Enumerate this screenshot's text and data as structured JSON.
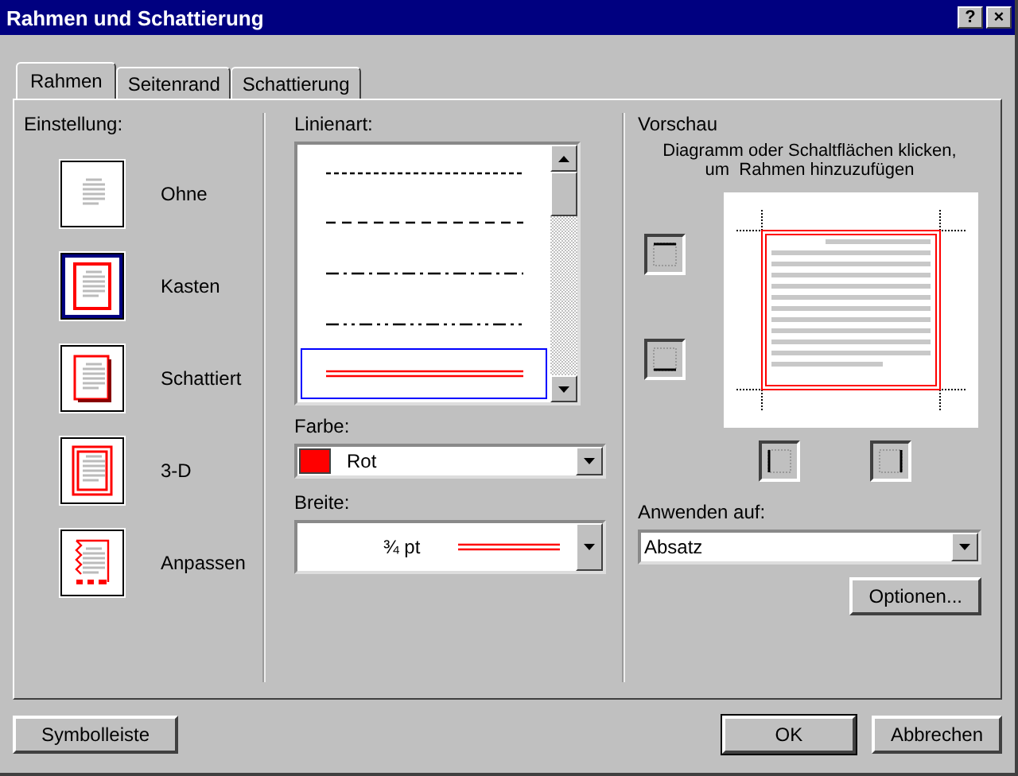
{
  "window": {
    "title": "Rahmen und Schattierung",
    "help_button": "?",
    "close_button": "×"
  },
  "tabs": [
    {
      "label": "Rahmen",
      "selected": true
    },
    {
      "label": "Seitenrand",
      "selected": false
    },
    {
      "label": "Schattierung",
      "selected": false
    }
  ],
  "settings": {
    "label": "Einstellung:",
    "items": [
      {
        "label": "Ohne",
        "kind": "none",
        "selected": false
      },
      {
        "label": "Kasten",
        "kind": "box",
        "selected": true
      },
      {
        "label": "Schattiert",
        "kind": "shadow",
        "selected": false
      },
      {
        "label": "3-D",
        "kind": "threed",
        "selected": false
      },
      {
        "label": "Anpassen",
        "kind": "custom",
        "selected": false
      }
    ]
  },
  "line_style": {
    "label": "Linienart:",
    "items": [
      {
        "kind": "dotted",
        "selected": false
      },
      {
        "kind": "dashed",
        "selected": false
      },
      {
        "kind": "dashdot",
        "selected": false
      },
      {
        "kind": "dashdotdot",
        "selected": false
      },
      {
        "kind": "double",
        "selected": true
      }
    ]
  },
  "color": {
    "label": "Farbe:",
    "value": "Rot",
    "color": "#ff0000"
  },
  "width": {
    "label": "Breite:",
    "value": "¾ pt"
  },
  "preview": {
    "title": "Vorschau",
    "hint": "Diagramm oder Schaltflächen klicken,\num  Rahmen hinzuzufügen"
  },
  "apply_to": {
    "label": "Anwenden auf:",
    "value": "Absatz"
  },
  "buttons": {
    "options": "Optionen...",
    "toolbar": "Symbolleiste",
    "ok": "OK",
    "cancel": "Abbrechen"
  }
}
